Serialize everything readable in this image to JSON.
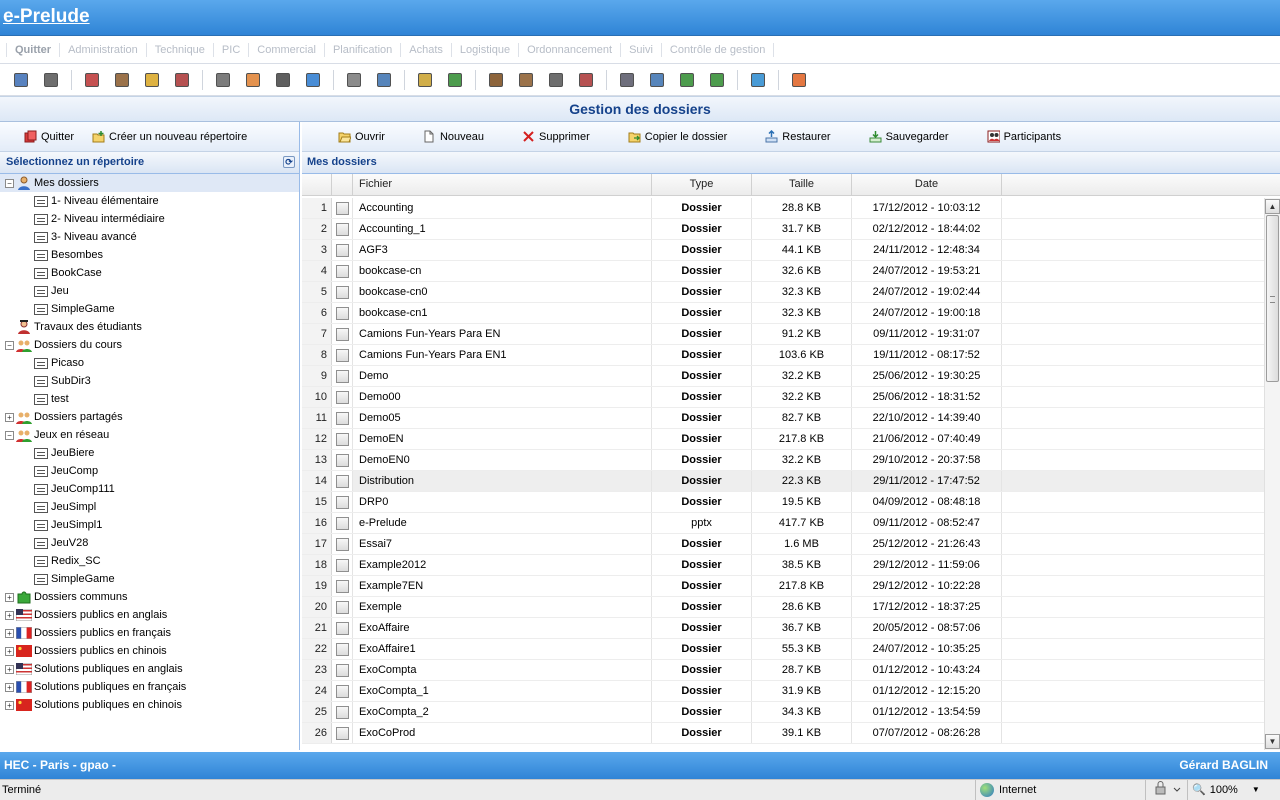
{
  "app": {
    "title": "e-Prelude"
  },
  "menu": [
    "Quitter",
    "Administration",
    "Technique",
    "PIC",
    "Commercial",
    "Planification",
    "Achats",
    "Logistique",
    "Ordonnancement",
    "Suivi",
    "Contrôle de gestion"
  ],
  "toolbar_icons": [
    "save-icon",
    "print-icon",
    "tool-icon",
    "book-icon",
    "folder-icon",
    "network-icon",
    "grid-icon",
    "sun-icon",
    "table-icon",
    "chart-icon",
    "gear-icon",
    "gear2-icon",
    "note-icon",
    "transfer-icon",
    "target-icon",
    "calendar-icon",
    "clock-icon",
    "edit-icon",
    "settings-icon",
    "home-icon",
    "users-icon",
    "puzzle-icon",
    "help-icon",
    "up-arrow-icon"
  ],
  "page": {
    "title": "Gestion des dossiers"
  },
  "left": {
    "buttons": {
      "quit": "Quitter",
      "new_dir": "Créer un nouveau répertoire"
    },
    "title": "Sélectionnez un répertoire",
    "tree": [
      {
        "label": "Mes dossiers",
        "level": 0,
        "expander": "−",
        "icon": "user-icon",
        "selected": true
      },
      {
        "label": "1- Niveau élémentaire",
        "level": 1,
        "icon": "file-icon"
      },
      {
        "label": "2- Niveau intermédiaire",
        "level": 1,
        "icon": "file-icon"
      },
      {
        "label": "3- Niveau avancé",
        "level": 1,
        "icon": "file-icon"
      },
      {
        "label": "Besombes",
        "level": 1,
        "icon": "file-icon"
      },
      {
        "label": "BookCase",
        "level": 1,
        "icon": "file-icon"
      },
      {
        "label": "Jeu",
        "level": 1,
        "icon": "file-icon"
      },
      {
        "label": "SimpleGame",
        "level": 1,
        "icon": "file-icon"
      },
      {
        "label": "Travaux des étudiants",
        "level": 0,
        "expander": "",
        "icon": "students-icon"
      },
      {
        "label": "Dossiers du cours",
        "level": 0,
        "expander": "−",
        "icon": "group-icon"
      },
      {
        "label": "Picaso",
        "level": 1,
        "icon": "file-icon"
      },
      {
        "label": "SubDir3",
        "level": 1,
        "icon": "file-icon"
      },
      {
        "label": "test",
        "level": 1,
        "icon": "file-icon"
      },
      {
        "label": "Dossiers partagés",
        "level": 0,
        "expander": "+",
        "icon": "group-icon"
      },
      {
        "label": "Jeux en réseau",
        "level": 0,
        "expander": "−",
        "icon": "group-icon"
      },
      {
        "label": "JeuBiere",
        "level": 1,
        "icon": "file-icon"
      },
      {
        "label": "JeuComp",
        "level": 1,
        "icon": "file-icon"
      },
      {
        "label": "JeuComp111",
        "level": 1,
        "icon": "file-icon"
      },
      {
        "label": "JeuSimpl",
        "level": 1,
        "icon": "file-icon"
      },
      {
        "label": "JeuSimpl1",
        "level": 1,
        "icon": "file-icon"
      },
      {
        "label": "JeuV28",
        "level": 1,
        "icon": "file-icon"
      },
      {
        "label": "Redix_SC",
        "level": 1,
        "icon": "file-icon"
      },
      {
        "label": "SimpleGame",
        "level": 1,
        "icon": "file-icon"
      },
      {
        "label": "Dossiers communs",
        "level": 0,
        "expander": "+",
        "icon": "puzzle-icon"
      },
      {
        "label": "Dossiers publics en anglais",
        "level": 0,
        "expander": "+",
        "icon": "flag-us-icon"
      },
      {
        "label": "Dossiers publics en français",
        "level": 0,
        "expander": "+",
        "icon": "flag-fr-icon"
      },
      {
        "label": "Dossiers publics en chinois",
        "level": 0,
        "expander": "+",
        "icon": "flag-cn-icon"
      },
      {
        "label": "Solutions publiques en anglais",
        "level": 0,
        "expander": "+",
        "icon": "flag-us-icon"
      },
      {
        "label": "Solutions publiques en français",
        "level": 0,
        "expander": "+",
        "icon": "flag-fr-icon"
      },
      {
        "label": "Solutions publiques en chinois",
        "level": 0,
        "expander": "+",
        "icon": "flag-cn-icon"
      }
    ]
  },
  "right": {
    "buttons": {
      "open": "Ouvrir",
      "new": "Nouveau",
      "delete": "Supprimer",
      "copy": "Copier le dossier",
      "restore": "Restaurer",
      "save": "Sauvegarder",
      "participants": "Participants"
    },
    "title": "Mes dossiers",
    "columns": {
      "file": "Fichier",
      "type": "Type",
      "size": "Taille",
      "date": "Date"
    },
    "rows": [
      {
        "n": "1",
        "name": "Accounting",
        "type": "Dossier",
        "size": "28.8 KB",
        "date": "17/12/2012 - 10:03:12"
      },
      {
        "n": "2",
        "name": "Accounting_1",
        "type": "Dossier",
        "size": "31.7 KB",
        "date": "02/12/2012 - 18:44:02"
      },
      {
        "n": "3",
        "name": "AGF3",
        "type": "Dossier",
        "size": "44.1 KB",
        "date": "24/11/2012 - 12:48:34"
      },
      {
        "n": "4",
        "name": "bookcase-cn",
        "type": "Dossier",
        "size": "32.6 KB",
        "date": "24/07/2012 - 19:53:21"
      },
      {
        "n": "5",
        "name": "bookcase-cn0",
        "type": "Dossier",
        "size": "32.3 KB",
        "date": "24/07/2012 - 19:02:44"
      },
      {
        "n": "6",
        "name": "bookcase-cn1",
        "type": "Dossier",
        "size": "32.3 KB",
        "date": "24/07/2012 - 19:00:18"
      },
      {
        "n": "7",
        "name": "Camions Fun-Years Para EN",
        "type": "Dossier",
        "size": "91.2 KB",
        "date": "09/11/2012 - 19:31:07"
      },
      {
        "n": "8",
        "name": "Camions Fun-Years Para EN1",
        "type": "Dossier",
        "size": "103.6 KB",
        "date": "19/11/2012 - 08:17:52"
      },
      {
        "n": "9",
        "name": "Demo",
        "type": "Dossier",
        "size": "32.2 KB",
        "date": "25/06/2012 - 19:30:25"
      },
      {
        "n": "10",
        "name": "Demo00",
        "type": "Dossier",
        "size": "32.2 KB",
        "date": "25/06/2012 - 18:31:52"
      },
      {
        "n": "11",
        "name": "Demo05",
        "type": "Dossier",
        "size": "82.7 KB",
        "date": "22/10/2012 - 14:39:40"
      },
      {
        "n": "12",
        "name": "DemoEN",
        "type": "Dossier",
        "size": "217.8 KB",
        "date": "21/06/2012 - 07:40:49"
      },
      {
        "n": "13",
        "name": "DemoEN0",
        "type": "Dossier",
        "size": "32.2 KB",
        "date": "29/10/2012 - 20:37:58"
      },
      {
        "n": "14",
        "name": "Distribution",
        "type": "Dossier",
        "size": "22.3 KB",
        "date": "29/11/2012 - 17:47:52",
        "highlight": true
      },
      {
        "n": "15",
        "name": "DRP0",
        "type": "Dossier",
        "size": "19.5 KB",
        "date": "04/09/2012 - 08:48:18"
      },
      {
        "n": "16",
        "name": "e-Prelude",
        "type": "pptx",
        "size": "417.7 KB",
        "date": "09/11/2012 - 08:52:47"
      },
      {
        "n": "17",
        "name": "Essai7",
        "type": "Dossier",
        "size": "1.6 MB",
        "date": "25/12/2012 - 21:26:43"
      },
      {
        "n": "18",
        "name": "Example2012",
        "type": "Dossier",
        "size": "38.5 KB",
        "date": "29/12/2012 - 11:59:06"
      },
      {
        "n": "19",
        "name": "Example7EN",
        "type": "Dossier",
        "size": "217.8 KB",
        "date": "29/12/2012 - 10:22:28"
      },
      {
        "n": "20",
        "name": "Exemple",
        "type": "Dossier",
        "size": "28.6 KB",
        "date": "17/12/2012 - 18:37:25"
      },
      {
        "n": "21",
        "name": "ExoAffaire",
        "type": "Dossier",
        "size": "36.7 KB",
        "date": "20/05/2012 - 08:57:06"
      },
      {
        "n": "22",
        "name": "ExoAffaire1",
        "type": "Dossier",
        "size": "55.3 KB",
        "date": "24/07/2012 - 10:35:25"
      },
      {
        "n": "23",
        "name": "ExoCompta",
        "type": "Dossier",
        "size": "28.7 KB",
        "date": "01/12/2012 - 10:43:24"
      },
      {
        "n": "24",
        "name": "ExoCompta_1",
        "type": "Dossier",
        "size": "31.9 KB",
        "date": "01/12/2012 - 12:15:20"
      },
      {
        "n": "25",
        "name": "ExoCompta_2",
        "type": "Dossier",
        "size": "34.3 KB",
        "date": "01/12/2012 - 13:54:59"
      },
      {
        "n": "26",
        "name": "ExoCoProd",
        "type": "Dossier",
        "size": "39.1 KB",
        "date": "07/07/2012 - 08:26:28"
      }
    ]
  },
  "footer": {
    "left": "HEC - Paris - gpao -",
    "right": "Gérard BAGLIN"
  },
  "status": {
    "text": "Terminé",
    "zone": "Internet",
    "zoom": "100%"
  },
  "colors": {
    "accent": "#2f84d6",
    "header_text": "#15428b"
  }
}
